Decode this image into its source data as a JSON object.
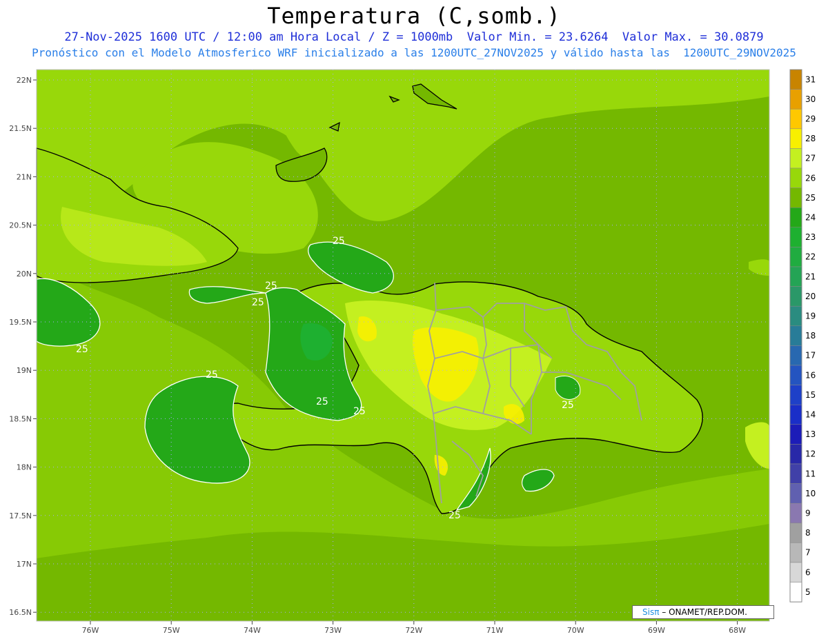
{
  "header": {
    "title": "Temperatura (C,somb.)",
    "line1": "27-Nov-2025 1600 UTC / 12:00 am Hora Local / Z = 1000mb  Valor Min. = 23.6264  Valor Max. = 30.0879",
    "line2": "Pronóstico con el Modelo Atmosferico WRF inicializado a las 1200UTC_27NOV2025 y válido hasta las  1200UTC_29NOV2025"
  },
  "axes": {
    "lat_labels": [
      "22N",
      "21.5N",
      "21N",
      "20.5N",
      "20N",
      "19.5N",
      "19N",
      "18.5N",
      "18N",
      "17.5N",
      "17N",
      "16.5N"
    ],
    "lon_labels": [
      "76W",
      "75W",
      "74W",
      "73W",
      "72W",
      "71W",
      "70W",
      "69W",
      "68W"
    ]
  },
  "contour_labels": [
    "25",
    "25",
    "25",
    "25",
    "25",
    "25",
    "25",
    "25",
    "25"
  ],
  "legend": {
    "values": [
      "31",
      "30",
      "29",
      "28",
      "27",
      "26",
      "25",
      "24",
      "23",
      "22",
      "21",
      "20",
      "19",
      "18",
      "17",
      "16",
      "15",
      "14",
      "13",
      "12",
      "11",
      "10",
      "9",
      "8",
      "7",
      "6",
      "5"
    ],
    "colors": [
      "#c88400",
      "#e8a000",
      "#ffc800",
      "#f8f000",
      "#c4f020",
      "#98d80a",
      "#74b800",
      "#24a818",
      "#1eb030",
      "#20ac40",
      "#24a455",
      "#2a9868",
      "#2a8c80",
      "#287c98",
      "#2868b0",
      "#2454c0",
      "#1e40c8",
      "#1a2ec8",
      "#1c1cb8",
      "#2828a8",
      "#4040a8",
      "#6060b0",
      "#8a78b0",
      "#a0a0a0",
      "#b8b8b8",
      "#d8d8d8",
      "#ffffff"
    ]
  },
  "credit": {
    "brand": "Sisπ",
    "text": "– ONAMET/REP.DOM."
  },
  "colors": {
    "ocean": "#74b800",
    "sea_band": "#98d80a",
    "warm": "#c4f020",
    "hot": "#f8f000",
    "cool": "#24a818",
    "contour": "#ffffff",
    "coast": "#000000",
    "border": "#a0a0a0"
  }
}
